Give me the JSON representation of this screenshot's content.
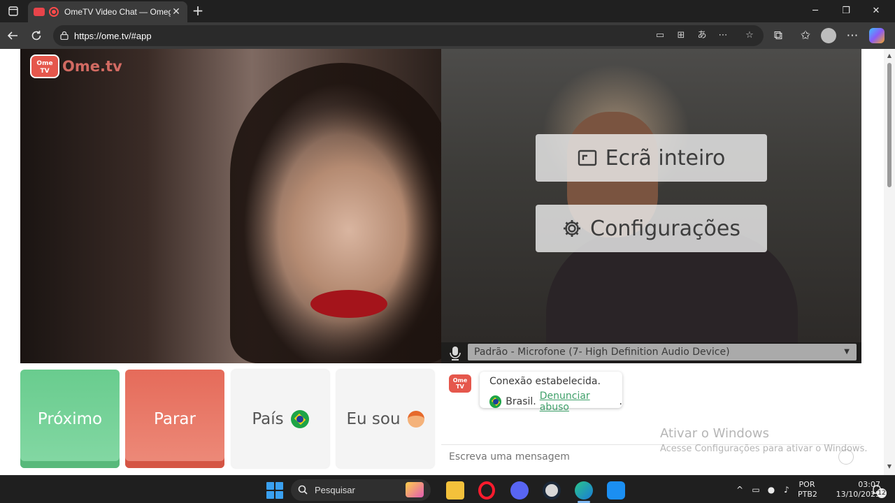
{
  "browser": {
    "tab_title": "OmeTV Video Chat — Omeg",
    "url": "https://ome.tv/#app"
  },
  "page": {
    "logo_text": "Ome.tv",
    "logo_badge": "Ome TV",
    "overlay": {
      "fullscreen_label": "Ecrã inteiro",
      "settings_label": "Configurações"
    },
    "microphone": {
      "selected": "Padrão - Microfone (7- High Definition Audio Device)"
    },
    "controls": {
      "next_label": "Próximo",
      "stop_label": "Parar",
      "country_label": "País",
      "gender_label": "Eu sou"
    },
    "chat": {
      "status_line": "Conexão estabelecida.",
      "country_name": "Brasil.",
      "report_link": "Denunciar abuso",
      "report_suffix": ".",
      "input_placeholder": "Escreva uma mensagem"
    },
    "watermark": {
      "title": "Ativar o Windows",
      "subtitle": "Acesse Configurações para ativar o Windows."
    }
  },
  "taskbar": {
    "search_label": "Pesquisar",
    "language_line1": "POR",
    "language_line2": "PTB2",
    "time": "03:07",
    "date": "13/10/2025",
    "notification_count": "12"
  }
}
